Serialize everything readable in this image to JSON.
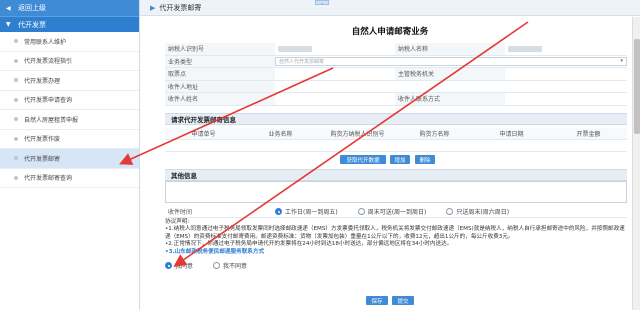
{
  "sidebar": {
    "back_label": "返回上级",
    "section_label": "代开发票",
    "items": [
      {
        "label": "常用联系人维护"
      },
      {
        "label": "代开发票流程指引"
      },
      {
        "label": "代开发票办理"
      },
      {
        "label": "代开发票申请查询"
      },
      {
        "label": "自然人房屋租赁申报"
      },
      {
        "label": "代开发票作废"
      },
      {
        "label": "代开发票邮寄"
      },
      {
        "label": "代开发票邮寄查询"
      }
    ]
  },
  "topbar": {
    "breadcrumb": "代开发票邮寄"
  },
  "page_title": "自然人申请邮寄业务",
  "form": {
    "taxpayer_id_label": "纳税人识别号",
    "taxpayer_name_label": "纳税人名称",
    "business_type_label": "业务类型",
    "business_type_value": "自然人代开发票邮寄",
    "pickup_point_label": "取票点",
    "tax_office_label": "主管税务机关",
    "recipient_address_label": "收件人地址",
    "recipient_name_label": "收件人姓名",
    "recipient_contact_label": "收件人联系方式"
  },
  "invoice_section": {
    "title": "请求代开发票邮寄信息",
    "columns": [
      "申请单号",
      "业务名称",
      "购货方纳税人识别号",
      "购货方名称",
      "申请日期",
      "开票金额"
    ],
    "buttons": {
      "fetch": "获取代开数据",
      "add": "增加",
      "delete": "删除"
    }
  },
  "other_section": {
    "title": "其他信息"
  },
  "delivery_time": {
    "label": "收件时间",
    "options": [
      "工作日(周一到周五)",
      "周末可送(周一到周日)",
      "只送周末(周六周日)"
    ],
    "selected_index": 0
  },
  "agreement": {
    "heading": "协议声明:",
    "line1": "•1.纳税人同意通过电子税务局领取发票同时选择邮政速递（EMS）方发票委托领取人，税务机关将发票交付邮政速递（EMS)就是纳税人，纳税人自行承担邮寄途中的风险，并按照邮政速递（EMS）的资费标准支付邮寄费用。邮递资费标准：货物（发票加包装）重量在1公斤以下的，收费12元，超出1公斤的，每公斤收费3元。",
    "line2": "•2.正常情况下，你通过电子税务局申请代开的发票将在24小时到达18小时送达，部分偏远地区将在34小时内送达。",
    "line3": "•3.山东邮政税务便民邮递服务联系方式",
    "agree": "我同意",
    "disagree": "我不同意"
  },
  "footer": {
    "save": "保存",
    "submit": "提交"
  }
}
